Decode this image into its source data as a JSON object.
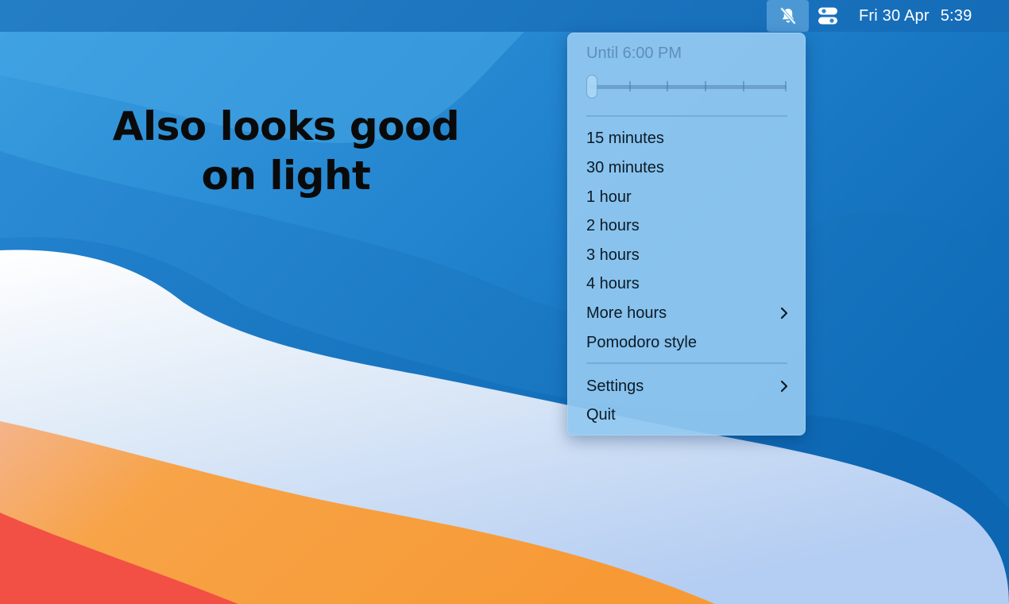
{
  "menubar": {
    "dnd_icon": "bell-slash-icon",
    "control_center_icon": "control-center-toggles-icon",
    "date": "Fri 30 Apr",
    "time": "5:39"
  },
  "headline": {
    "line1": "Also looks good",
    "line2": "on light"
  },
  "menu": {
    "until_label": "Until 6:00 PM",
    "slider_value_fraction": 0.0,
    "durations": [
      {
        "label": "15 minutes"
      },
      {
        "label": "30 minutes"
      },
      {
        "label": "1 hour"
      },
      {
        "label": "2 hours"
      },
      {
        "label": "3 hours"
      },
      {
        "label": "4 hours"
      },
      {
        "label": "More hours",
        "submenu": true
      },
      {
        "label": "Pomodoro style"
      }
    ],
    "footer": [
      {
        "label": "Settings",
        "submenu": true
      },
      {
        "label": "Quit"
      }
    ]
  },
  "colors": {
    "wallpaper_blue": "#1d78c4",
    "wallpaper_orange": "#f7a140",
    "wallpaper_red": "#f25045",
    "menu_background": "#91c8f0"
  }
}
